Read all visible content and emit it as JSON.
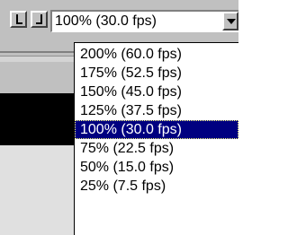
{
  "toolbar": {
    "left_button_icon": "step-left-icon",
    "right_button_icon": "step-right-icon"
  },
  "speed_select": {
    "value": "100% (30.0 fps)",
    "arrow_icon": "chevron-down-icon",
    "options": [
      "200% (60.0 fps)",
      "175% (52.5 fps)",
      "150% (45.0 fps)",
      "125% (37.5 fps)",
      "100% (30.0 fps)",
      "75% (22.5 fps)",
      "50% (15.0 fps)",
      "25% (7.5 fps)"
    ],
    "selected_index": 4
  },
  "colors": {
    "face": "#c0c0c0",
    "highlight": "#000080",
    "highlight_text": "#ffffff"
  }
}
